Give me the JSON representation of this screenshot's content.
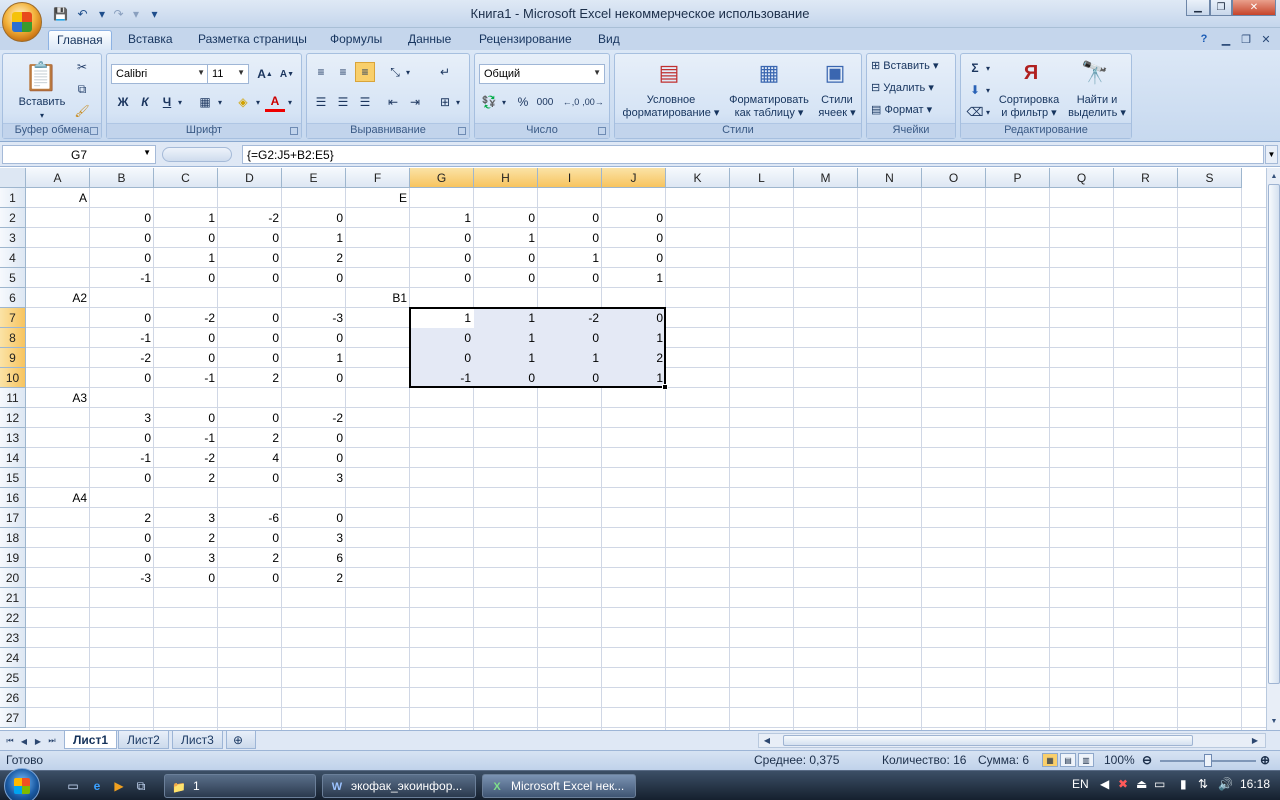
{
  "window": {
    "title": "Книга1 - Microsoft Excel некоммерческое использование",
    "minimize": "▁",
    "restore": "❐",
    "close": "✕"
  },
  "qat": {
    "save": "💾",
    "undo": "↶",
    "redo": "↷",
    "customize": "▾"
  },
  "tabs": [
    "Главная",
    "Вставка",
    "Разметка страницы",
    "Формулы",
    "Данные",
    "Рецензирование",
    "Вид"
  ],
  "ribbon": {
    "clipboard": {
      "label": "Буфер обмена",
      "paste": "Вставить"
    },
    "font": {
      "label": "Шрифт",
      "name": "Calibri",
      "size": "11",
      "bold": "Ж",
      "italic": "К",
      "underline": "Ч"
    },
    "alignment": {
      "label": "Выравнивание"
    },
    "number": {
      "label": "Число",
      "format": "Общий",
      "percent": "%",
      "thousands": "000"
    },
    "styles": {
      "label": "Стили",
      "conditional_1": "Условное",
      "conditional_2": "форматирование",
      "astable_1": "Форматировать",
      "astable_2": "как таблицу",
      "cellstyles_1": "Стили",
      "cellstyles_2": "ячеек"
    },
    "cells": {
      "label": "Ячейки",
      "insert": "Вставить",
      "delete": "Удалить",
      "format": "Формат"
    },
    "editing": {
      "label": "Редактирование",
      "sort_1": "Сортировка",
      "sort_2": "и фильтр",
      "find_1": "Найти и",
      "find_2": "выделить"
    }
  },
  "formula_bar": {
    "name_box": "G7",
    "formula": "{=G2:J5+B2:E5}"
  },
  "grid": {
    "columns": [
      "A",
      "B",
      "C",
      "D",
      "E",
      "F",
      "G",
      "H",
      "I",
      "J",
      "K",
      "L",
      "M",
      "N",
      "O",
      "P",
      "Q",
      "R",
      "S"
    ],
    "rows": [
      "1",
      "2",
      "3",
      "4",
      "5",
      "6",
      "7",
      "8",
      "9",
      "10",
      "11",
      "12",
      "13",
      "14",
      "15",
      "16",
      "17",
      "18",
      "19",
      "20",
      "21",
      "22",
      "23",
      "24",
      "25",
      "26",
      "27"
    ],
    "cells": {
      "A1": "A",
      "F1": "E",
      "B2": "0",
      "C2": "1",
      "D2": "-2",
      "E2": "0",
      "G2": "1",
      "H2": "0",
      "I2": "0",
      "J2": "0",
      "B3": "0",
      "C3": "0",
      "D3": "0",
      "E3": "1",
      "G3": "0",
      "H3": "1",
      "I3": "0",
      "J3": "0",
      "B4": "0",
      "C4": "1",
      "D4": "0",
      "E4": "2",
      "G4": "0",
      "H4": "0",
      "I4": "1",
      "J4": "0",
      "B5": "-1",
      "C5": "0",
      "D5": "0",
      "E5": "0",
      "G5": "0",
      "H5": "0",
      "I5": "0",
      "J5": "1",
      "A6": "A2",
      "F6": "B1",
      "B7": "0",
      "C7": "-2",
      "D7": "0",
      "E7": "-3",
      "G7": "1",
      "H7": "1",
      "I7": "-2",
      "J7": "0",
      "B8": "-1",
      "C8": "0",
      "D8": "0",
      "E8": "0",
      "G8": "0",
      "H8": "1",
      "I8": "0",
      "J8": "1",
      "B9": "-2",
      "C9": "0",
      "D9": "0",
      "E9": "1",
      "G9": "0",
      "H9": "1",
      "I9": "1",
      "J9": "2",
      "B10": "0",
      "C10": "-1",
      "D10": "2",
      "E10": "0",
      "G10": "-1",
      "H10": "0",
      "I10": "0",
      "J10": "1",
      "A11": "A3",
      "B12": "3",
      "C12": "0",
      "D12": "0",
      "E12": "-2",
      "B13": "0",
      "C13": "-1",
      "D13": "2",
      "E13": "0",
      "B14": "-1",
      "C14": "-2",
      "D14": "4",
      "E14": "0",
      "B15": "0",
      "C15": "2",
      "D15": "0",
      "E15": "3",
      "A16": "A4",
      "B17": "2",
      "C17": "3",
      "D17": "-6",
      "E17": "0",
      "B18": "0",
      "C18": "2",
      "D18": "0",
      "E18": "3",
      "B19": "0",
      "C19": "3",
      "D19": "2",
      "E19": "6",
      "B20": "-3",
      "C20": "0",
      "D20": "0",
      "E20": "2"
    }
  },
  "sheets": [
    "Лист1",
    "Лист2",
    "Лист3"
  ],
  "status": {
    "ready": "Готово",
    "average": "Среднее: 0,375",
    "count": "Количество: 16",
    "sum": "Сумма: 6",
    "zoom": "100%"
  },
  "taskbar": {
    "items": [
      {
        "label": "1",
        "icon": "folder-icon"
      },
      {
        "label": "экофак_экоинфор...",
        "icon": "word-icon"
      },
      {
        "label": "Microsoft Excel нек...",
        "icon": "excel-icon"
      }
    ],
    "lang": "EN",
    "clock": "16:18"
  }
}
